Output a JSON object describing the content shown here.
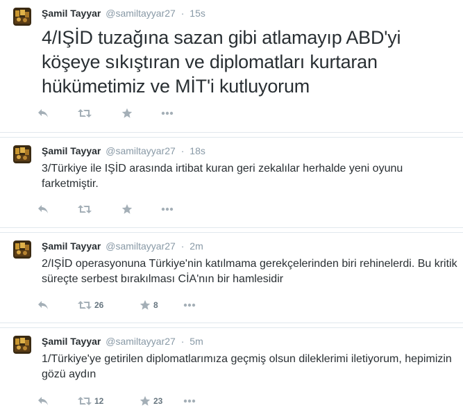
{
  "tweets": [
    {
      "fullname": "Şamil Tayyar",
      "username": "@samiltayyar27",
      "separator": "·",
      "time": "15s",
      "text": "4/IŞİD tuzağına sazan gibi atlamayıp ABD'yi köşeye sıkıştıran ve diplomatları kurtaran hükümetimiz ve MİT'i kutluyorum",
      "retweet_count": "",
      "favorite_count": ""
    },
    {
      "fullname": "Şamil Tayyar",
      "username": "@samiltayyar27",
      "separator": "·",
      "time": "18s",
      "text": "3/Türkiye ile IŞİD arasında irtibat kuran geri zekalılar herhalde yeni oyunu farketmiştir.",
      "retweet_count": "",
      "favorite_count": ""
    },
    {
      "fullname": "Şamil Tayyar",
      "username": "@samiltayyar27",
      "separator": "·",
      "time": "2m",
      "text": "2/IŞİD operasyonuna Türkiye'nin katılmama gerekçelerinden biri rehinelerdi. Bu kritik süreçte serbest bırakılması CİA'nın bir hamlesidir",
      "retweet_count": "26",
      "favorite_count": "8"
    },
    {
      "fullname": "Şamil Tayyar",
      "username": "@samiltayyar27",
      "separator": "·",
      "time": "5m",
      "text": "1/Türkiye'ye getirilen diplomatlarımıza geçmiş olsun dileklerimi iletiyorum, hepimizin gözü aydın",
      "retweet_count": "12",
      "favorite_count": "23"
    }
  ],
  "colors": {
    "text": "#292f33",
    "muted": "#8899a6",
    "icon": "#a4afb7",
    "divider": "#e1e8ed"
  },
  "icons": [
    "reply-icon",
    "retweet-icon",
    "favorite-icon",
    "more-icon"
  ]
}
